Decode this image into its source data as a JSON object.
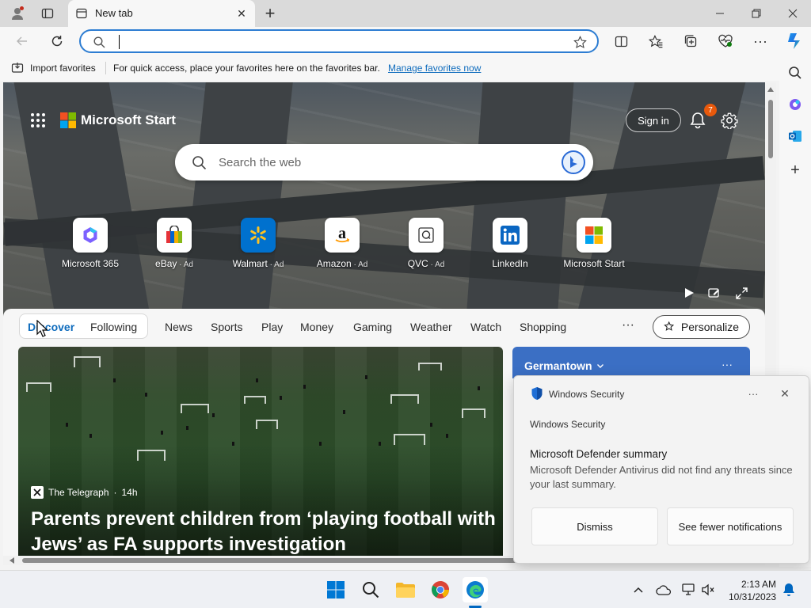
{
  "browser": {
    "tab_title": "New tab",
    "address_value": ""
  },
  "favorites_bar": {
    "import_label": "Import favorites",
    "hint": "For quick access, place your favorites here on the favorites bar.",
    "manage_link": "Manage favorites now"
  },
  "start_page": {
    "brand": "Microsoft Start",
    "sign_in": "Sign in",
    "notification_count": "7",
    "search_placeholder": "Search the web",
    "tiles": [
      {
        "label": "Microsoft 365",
        "ad": ""
      },
      {
        "label": "eBay",
        "ad": "Ad"
      },
      {
        "label": "Walmart",
        "ad": "Ad"
      },
      {
        "label": "Amazon",
        "ad": "Ad"
      },
      {
        "label": "QVC",
        "ad": "Ad"
      },
      {
        "label": "LinkedIn",
        "ad": ""
      },
      {
        "label": "Microsoft Start",
        "ad": ""
      }
    ],
    "nav": {
      "discover": "Discover",
      "following": "Following",
      "items": [
        "News",
        "Sports",
        "Play",
        "Money",
        "Gaming",
        "Weather",
        "Watch",
        "Shopping"
      ],
      "more": "···",
      "personalize": "Personalize"
    },
    "article": {
      "source": "The Telegraph",
      "age": "14h",
      "title": "Parents prevent children from ‘playing football with Jews’ as FA supports investigation"
    },
    "weather": {
      "location": "Germantown"
    }
  },
  "toast": {
    "app_name": "Windows Security",
    "source": "Windows Security",
    "title": "Microsoft Defender summary",
    "body": "Microsoft Defender Antivirus did not find any threats since your last summary.",
    "dismiss": "Dismiss",
    "see_fewer": "See fewer notifications"
  },
  "taskbar": {
    "time": "2:13 AM",
    "date": "10/31/2023"
  },
  "colors": {
    "accent": "#0f6cbd",
    "badge": "#e8590c",
    "weather_card": "#3b6fc4"
  }
}
